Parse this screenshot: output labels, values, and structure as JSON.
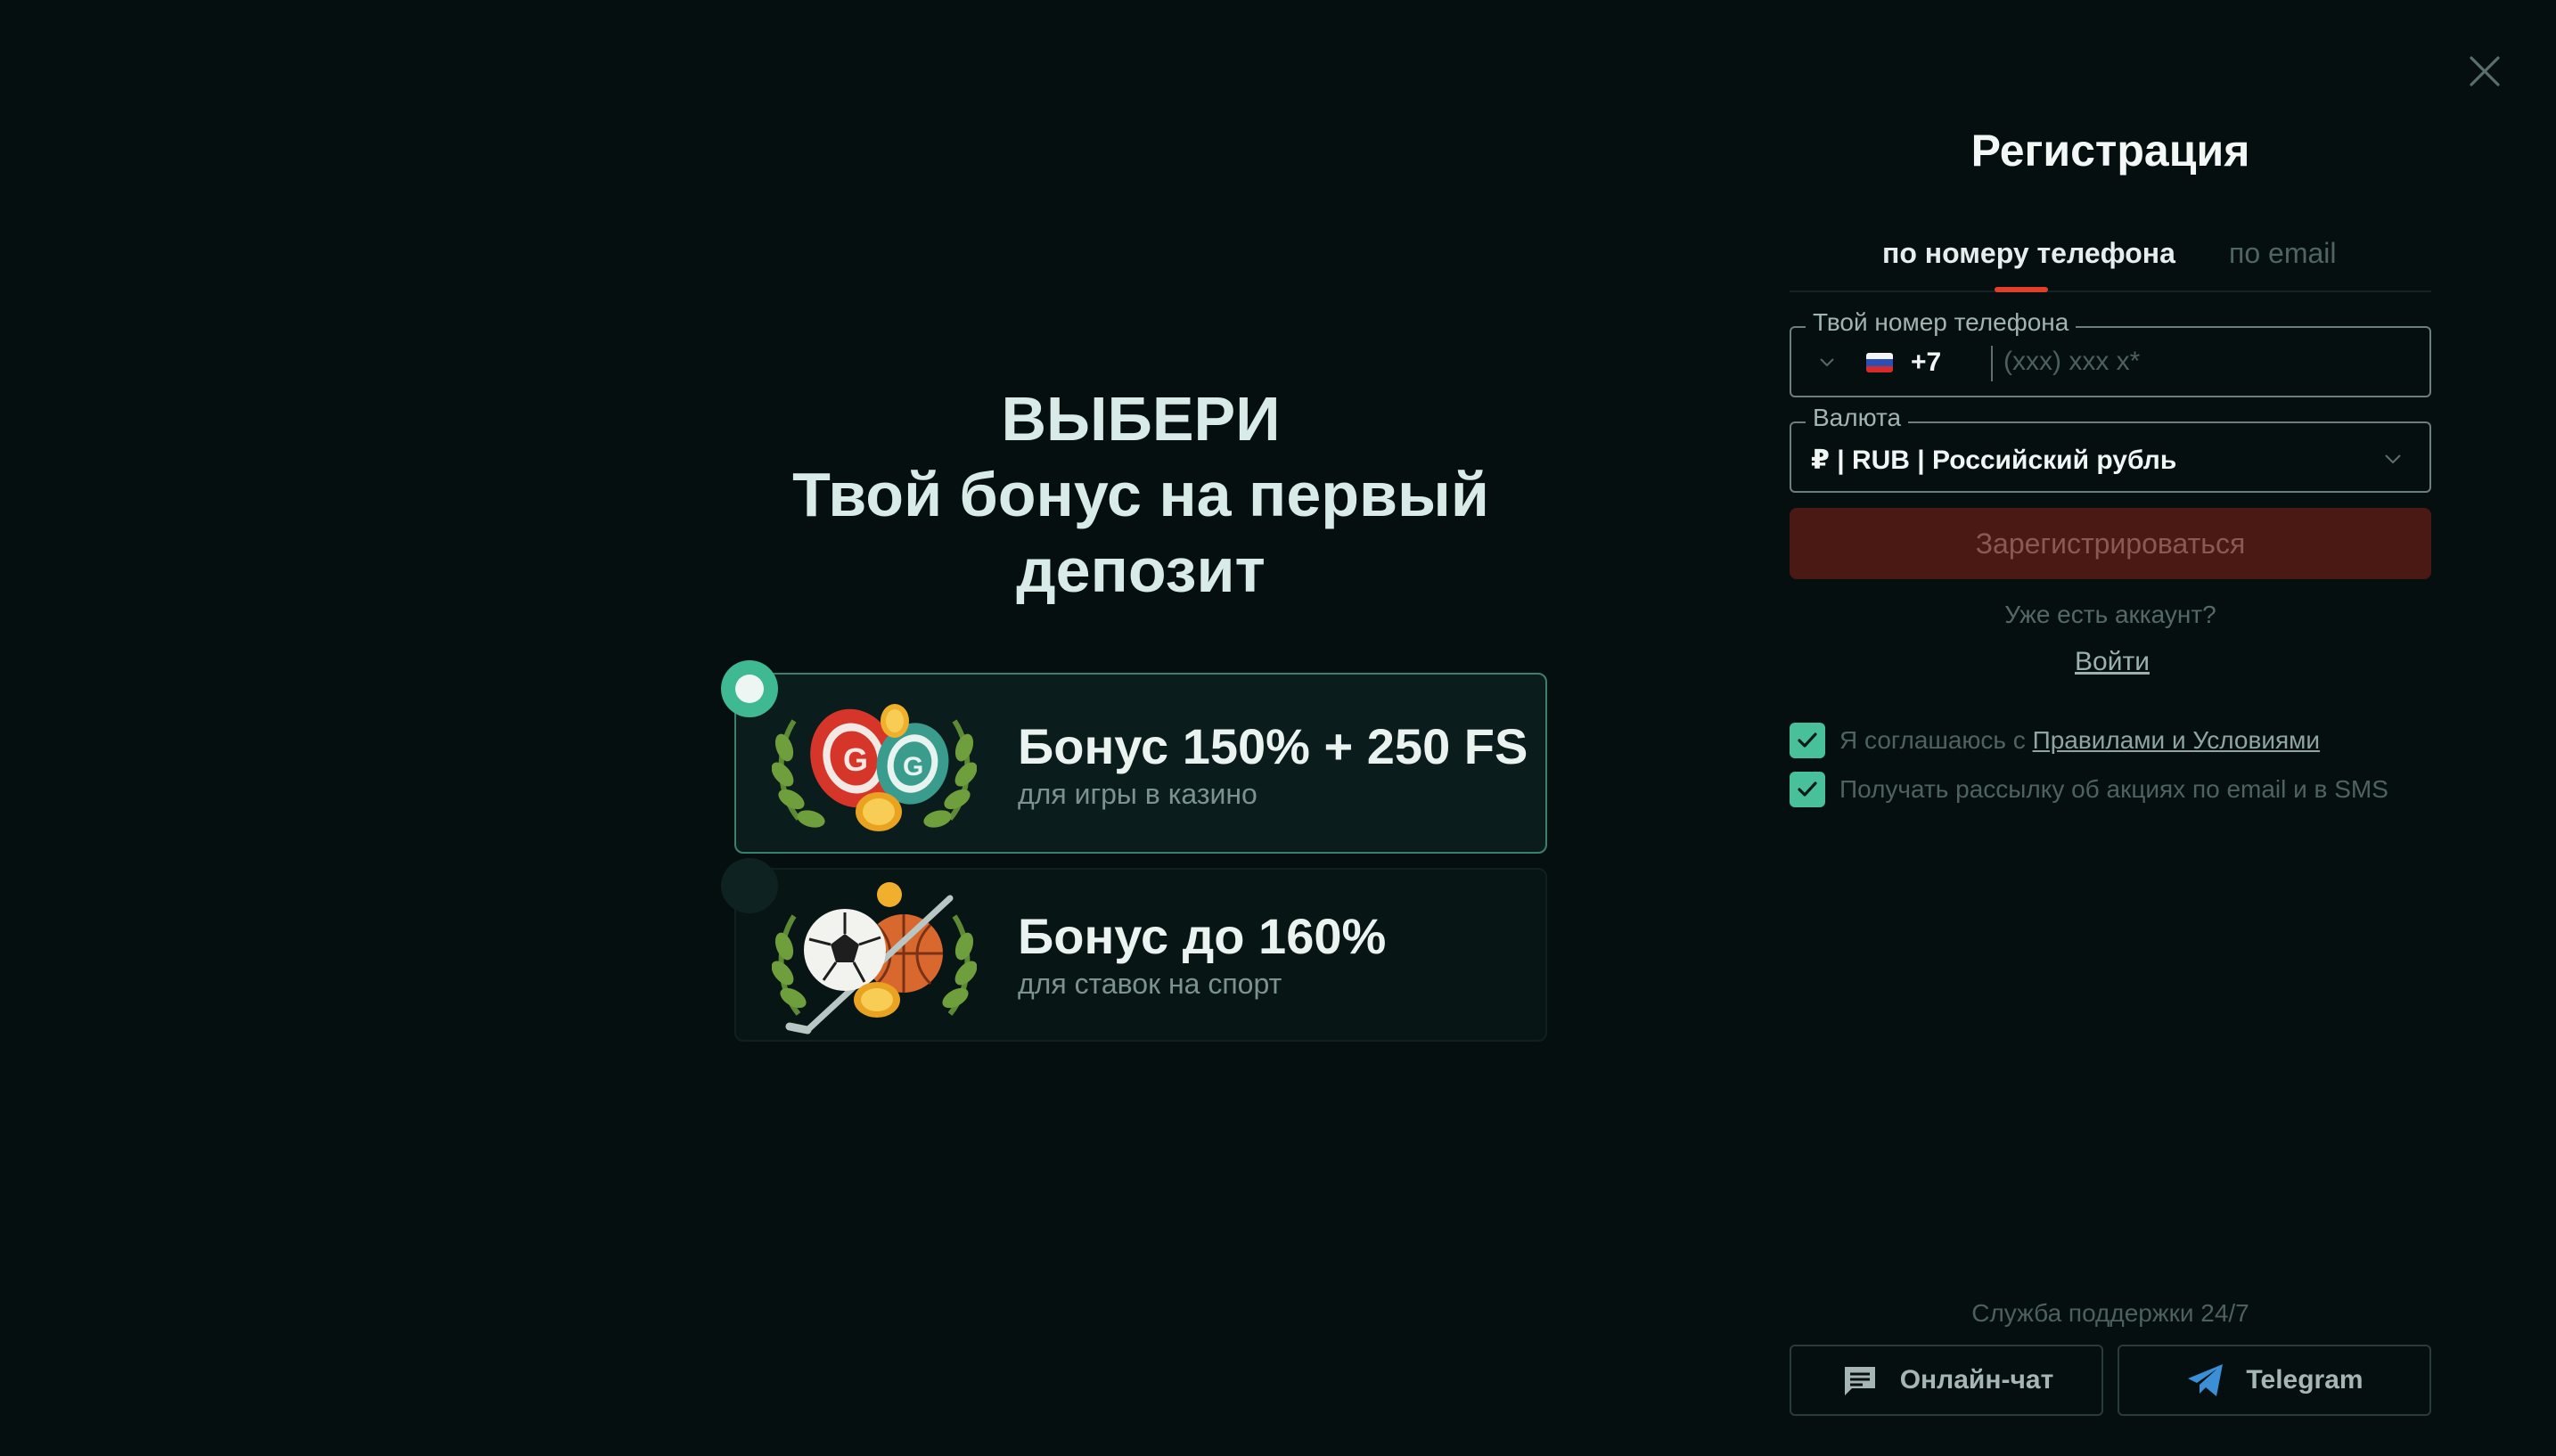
{
  "hero": {
    "line1": "ВЫБЕРИ",
    "line2": "Твой бонус на первый",
    "line3": "депозит"
  },
  "bonuses": [
    {
      "title": "Бонус 150% + 250 FS",
      "subtitle": "для игры в казино",
      "selected": true,
      "icon": "casino-chips-icon"
    },
    {
      "title": "Бонус до 160%",
      "subtitle": "для ставок на спорт",
      "selected": false,
      "icon": "sports-balls-icon"
    }
  ],
  "registration": {
    "title": "Регистрация",
    "tabs": [
      {
        "label": "по номеру телефона",
        "active": true
      },
      {
        "label": "по email",
        "active": false
      }
    ],
    "phone": {
      "legend": "Твой номер телефона",
      "country_code": "+7",
      "placeholder": "(xxx) xxx x*",
      "value": ""
    },
    "currency": {
      "legend": "Валюта",
      "selected": "₽ | RUB | Российский рубль"
    },
    "submit_label": "Зарегистрироваться",
    "have_account": "Уже есть аккаунт?",
    "login_label": "Войти",
    "consents": [
      {
        "prefix": "Я соглашаюсь с ",
        "link": "Правилами и Условиями",
        "checked": true
      },
      {
        "prefix": "Получать рассылку об акциях по email и в SMS",
        "link": "",
        "checked": true
      }
    ]
  },
  "support": {
    "label": "Служба поддержки 24/7",
    "chat_label": "Онлайн-чат",
    "telegram_label": "Telegram"
  },
  "colors": {
    "background": "#050f0f",
    "accent_red": "#e0402a",
    "accent_green": "#48c19a",
    "register_button": "#4a1913",
    "telegram_blue": "#3a8fd6"
  }
}
